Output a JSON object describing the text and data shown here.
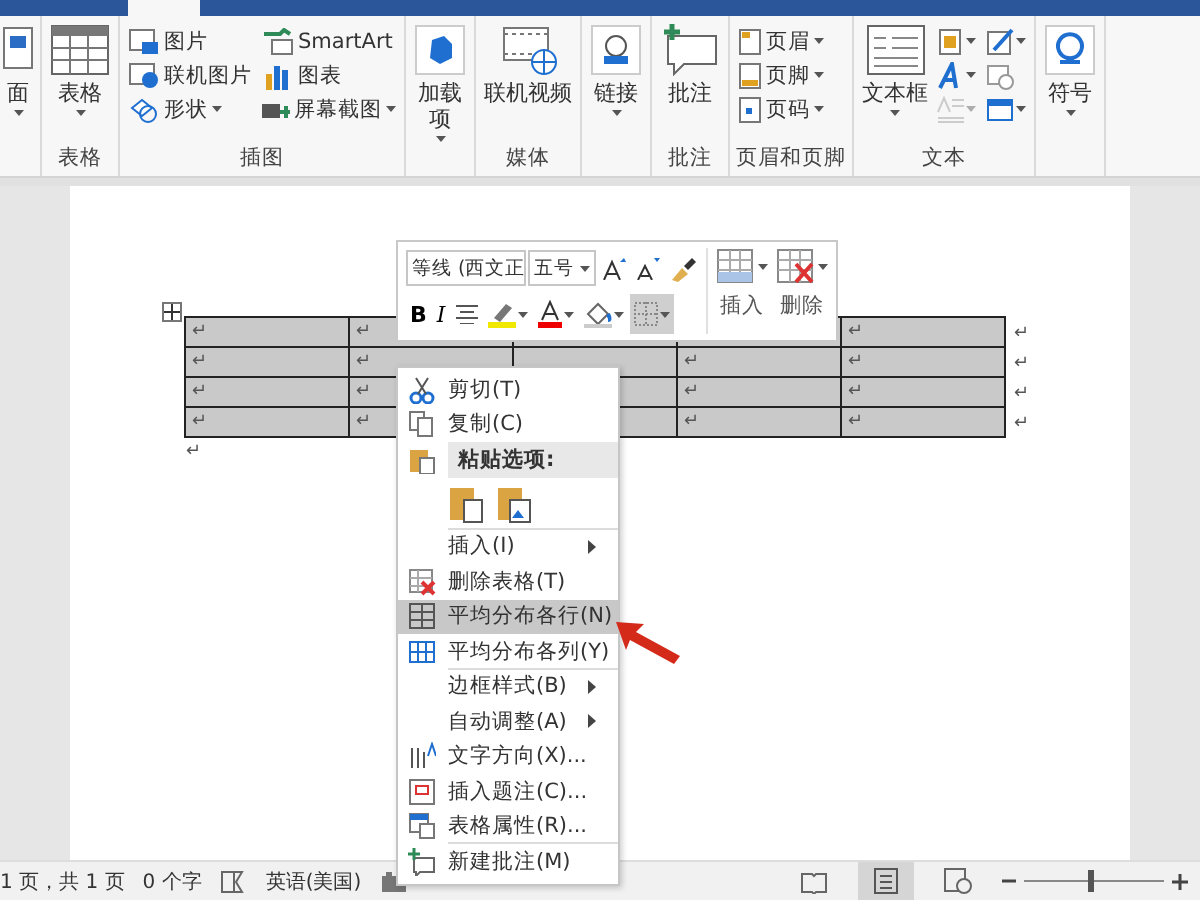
{
  "ribbon": {
    "groups": [
      {
        "buttons": [
          {
            "kind": "large",
            "label": "面",
            "dropdown": true
          }
        ]
      },
      {
        "label": "表格",
        "buttons": [
          {
            "kind": "large",
            "label": "表格",
            "dropdown": true
          }
        ]
      },
      {
        "label": "插图",
        "buttons": [
          {
            "kind": "small",
            "label": "图片",
            "dropdown": false
          },
          {
            "kind": "small",
            "label": "联机图片",
            "dropdown": false
          },
          {
            "kind": "small",
            "label": "形状",
            "dropdown": true
          },
          {
            "kind": "small",
            "label": "SmartArt",
            "dropdown": false
          },
          {
            "kind": "small",
            "label": "图表",
            "dropdown": false
          },
          {
            "kind": "small",
            "label": "屏幕截图",
            "dropdown": true
          }
        ]
      },
      {
        "buttons": [
          {
            "kind": "large",
            "label": "加载项",
            "dropdown": true
          }
        ]
      },
      {
        "label": "媒体",
        "buttons": [
          {
            "kind": "large",
            "label": "联机视频",
            "dropdown": false
          }
        ]
      },
      {
        "buttons": [
          {
            "kind": "large",
            "label": "链接",
            "dropdown": true
          }
        ]
      },
      {
        "label": "批注",
        "buttons": [
          {
            "kind": "large",
            "label": "批注",
            "dropdown": false
          }
        ]
      },
      {
        "label": "页眉和页脚",
        "buttons": [
          {
            "kind": "small",
            "label": "页眉",
            "dropdown": true
          },
          {
            "kind": "small",
            "label": "页脚",
            "dropdown": true
          },
          {
            "kind": "small",
            "label": "页码",
            "dropdown": true
          }
        ]
      },
      {
        "label": "文本",
        "buttons": [
          {
            "kind": "large",
            "label": "文本框",
            "dropdown": true
          },
          {
            "kind": "icon",
            "dropdown": true,
            "disabled": false
          },
          {
            "kind": "icon",
            "dropdown": true,
            "disabled": false
          },
          {
            "kind": "icon",
            "dropdown": true,
            "disabled": true
          },
          {
            "kind": "icon",
            "dropdown": true,
            "disabled": false
          },
          {
            "kind": "icon",
            "dropdown": false,
            "disabled": false
          },
          {
            "kind": "icon",
            "dropdown": true,
            "disabled": false
          }
        ]
      },
      {
        "buttons": [
          {
            "kind": "large",
            "label": "符号",
            "dropdown": true
          }
        ]
      }
    ]
  },
  "table": {
    "rows": [
      {
        "cells": [
          "↵",
          "↵",
          null,
          null,
          "↵"
        ],
        "end_mark": "↵"
      },
      {
        "cells": [
          "↵",
          "↵",
          null,
          "↵",
          "↵"
        ],
        "end_mark": "↵"
      },
      {
        "cells": [
          "↵",
          "↵",
          null,
          "↵",
          "↵"
        ],
        "end_mark": "↵"
      },
      {
        "cells": [
          "↵",
          "↵",
          null,
          "↵",
          "↵"
        ],
        "end_mark": "↵"
      }
    ],
    "after_mark": "↵"
  },
  "mini_toolbar": {
    "font": "等线 (西文正",
    "size": "五号",
    "format_buttons": [
      {
        "kind": "bold",
        "label": "B",
        "selected": false
      },
      {
        "kind": "italic",
        "label": "I",
        "selected": false
      },
      {
        "kind": "align",
        "selected": false
      },
      {
        "kind": "highlight",
        "selected": false
      },
      {
        "kind": "font_color",
        "selected": false
      },
      {
        "kind": "shading",
        "selected": false
      },
      {
        "kind": "borders",
        "selected": true
      }
    ],
    "table_buttons": [
      {
        "kind": "insert",
        "label": "插入"
      },
      {
        "kind": "delete",
        "label": "删除"
      }
    ]
  },
  "context_menu": {
    "items": [
      {
        "kind": "item",
        "label": "剪切(T)",
        "selected": false,
        "submenu": false,
        "separator": false
      },
      {
        "kind": "item",
        "label": "复制(C)",
        "selected": false,
        "submenu": false,
        "separator": false
      },
      {
        "kind": "header",
        "label": "粘贴选项:"
      },
      {
        "kind": "paste",
        "separator": true
      },
      {
        "kind": "item",
        "label": "插入(I)",
        "selected": false,
        "submenu": true,
        "separator": false
      },
      {
        "kind": "item",
        "label": "删除表格(T)",
        "selected": false,
        "submenu": false,
        "separator": false
      },
      {
        "kind": "item",
        "label": "平均分布各行(N)",
        "selected": true,
        "submenu": false,
        "separator": false
      },
      {
        "kind": "item",
        "label": "平均分布各列(Y)",
        "selected": false,
        "submenu": false,
        "separator": true
      },
      {
        "kind": "item",
        "label": "边框样式(B)",
        "selected": false,
        "submenu": true,
        "separator": false
      },
      {
        "kind": "item",
        "label": "自动调整(A)",
        "selected": false,
        "submenu": true,
        "separator": false
      },
      {
        "kind": "item",
        "label": "文字方向(X)...",
        "selected": false,
        "submenu": false,
        "separator": false
      },
      {
        "kind": "item",
        "label": "插入题注(C)...",
        "selected": false,
        "submenu": false,
        "separator": false
      },
      {
        "kind": "item",
        "label": "表格属性(R)...",
        "selected": false,
        "submenu": false,
        "separator": true
      },
      {
        "kind": "item",
        "label": "新建批注(M)",
        "selected": false,
        "submenu": false,
        "separator": false
      }
    ]
  },
  "status_bar": {
    "page": "1 页，共 1 页",
    "words": "0 个字",
    "language": "英语(美国)",
    "views": [
      {
        "kind": "read",
        "selected": false
      },
      {
        "kind": "print",
        "selected": true
      },
      {
        "kind": "web",
        "selected": false
      }
    ],
    "zoom": {
      "level": 0.45
    }
  }
}
